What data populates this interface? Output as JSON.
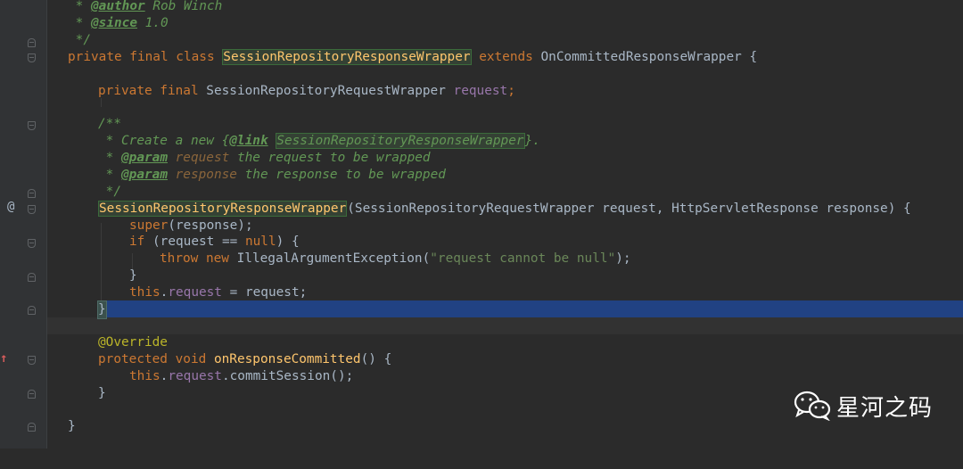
{
  "editor": {
    "theme": "darcula",
    "colors": {
      "background": "#2b2b2b",
      "keyword": "#cc7832",
      "comment": "#629755",
      "string": "#6a8759",
      "field": "#9876aa",
      "annotation": "#bbb529",
      "method_declaration": "#ffc66d",
      "selection": "#214283"
    }
  },
  "lines": [
    {
      "segments": [
        " * ",
        "@author",
        " Rob Winch"
      ]
    },
    {
      "segments": [
        " * ",
        "@since",
        " 1.0"
      ]
    },
    {
      "segments": [
        " */"
      ]
    },
    {
      "segments": [
        "private final class ",
        "SessionRepositoryResponseWrapper",
        " extends ",
        "OnCommittedResponseWrapper {"
      ]
    },
    {
      "segments": [
        ""
      ]
    },
    {
      "segments": [
        "private final ",
        "SessionRepositoryRequestWrapper ",
        "request",
        ";"
      ]
    },
    {
      "segments": [
        ""
      ]
    },
    {
      "segments": [
        "/**"
      ]
    },
    {
      "segments": [
        " * Create a new ",
        "{",
        "@link",
        " ",
        "SessionRepositoryResponseWrapper",
        "}",
        "."
      ]
    },
    {
      "segments": [
        " * ",
        "@param",
        " request",
        " the request to be wrapped"
      ]
    },
    {
      "segments": [
        " * ",
        "@param",
        " response",
        " the response to be wrapped"
      ]
    },
    {
      "segments": [
        " */"
      ]
    },
    {
      "segments": [
        "SessionRepositoryResponseWrapper",
        "(SessionRepositoryRequestWrapper request, HttpServletResponse response) {"
      ]
    },
    {
      "segments": [
        "super",
        "(response);"
      ]
    },
    {
      "segments": [
        "if ",
        "(request == ",
        "null",
        ") {"
      ]
    },
    {
      "segments": [
        "throw new ",
        "IllegalArgumentException(",
        "\"request cannot be null\"",
        ");"
      ]
    },
    {
      "segments": [
        "}"
      ]
    },
    {
      "segments": [
        "this",
        ".",
        "request",
        " = request;"
      ]
    },
    {
      "segments": [
        "}"
      ]
    },
    {
      "segments": [
        ""
      ]
    },
    {
      "segments": [
        "@Override"
      ]
    },
    {
      "segments": [
        "protected void ",
        "onResponseCommitted",
        "() {"
      ]
    },
    {
      "segments": [
        "this",
        ".",
        "request",
        ".commitSession();"
      ]
    },
    {
      "segments": [
        "}"
      ]
    },
    {
      "segments": [
        ""
      ]
    },
    {
      "segments": [
        "}"
      ]
    }
  ],
  "gutter": {
    "override_marker": "@",
    "implements_marker": "↑"
  },
  "watermark": {
    "text": "星河之码",
    "icon": "wechat-icon"
  }
}
